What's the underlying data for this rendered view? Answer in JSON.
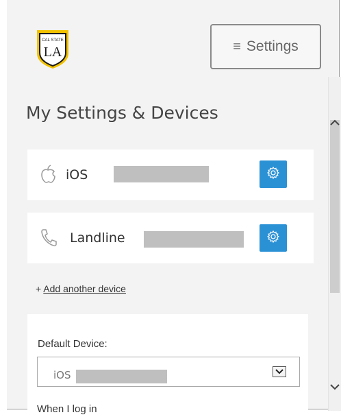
{
  "header": {
    "logo_text_small": "CAL STATE",
    "logo_text": "LA",
    "settings_label": "Settings",
    "menu_icon": "hamburger-icon"
  },
  "page": {
    "title": "My Settings & Devices"
  },
  "devices": [
    {
      "icon": "apple-icon",
      "label": "iOS",
      "action_icon": "gear-icon"
    },
    {
      "icon": "phone-icon",
      "label": "Landline",
      "action_icon": "gear-icon"
    }
  ],
  "add_device": {
    "prefix": "+ ",
    "link_label": "Add another device"
  },
  "default_device": {
    "label": "Default Device:",
    "selected": "iOS"
  },
  "partial_text": "When I log in",
  "colors": {
    "accent": "#2b91d5",
    "logo_gold": "#f2c200",
    "background": "#f3f3f3"
  }
}
